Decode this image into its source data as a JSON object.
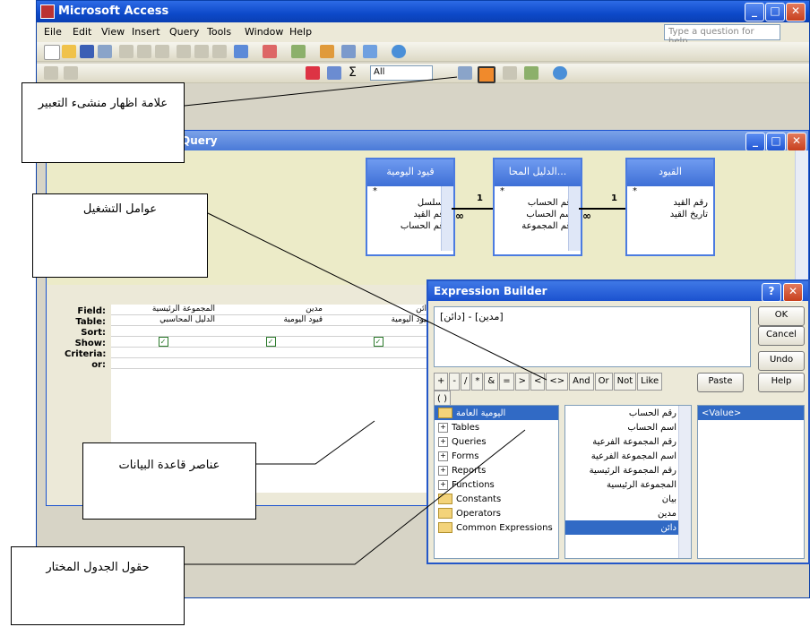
{
  "app": {
    "title": "Microsoft Access",
    "help_placeholder": "Type a question for help"
  },
  "menu": [
    "Eile",
    "Edit",
    "View",
    "Insert",
    "Query",
    "Tools",
    "Window",
    "Help"
  ],
  "toolbar2": {
    "all_value": "All",
    "sigma": "Σ"
  },
  "query_window": {
    "title": "Query",
    "tables": [
      {
        "name": "قيود اليومية",
        "fields": [
          "*",
          "مسلسل",
          "رقم القيد",
          "رقم الحساب"
        ]
      },
      {
        "name": "الدليل المحا...",
        "fields": [
          "*",
          "رقم الحساب",
          "اسم الحساب",
          "رقم المجموعة"
        ]
      },
      {
        "name": "القيود",
        "fields": [
          "*",
          "رقم القيد",
          "تاريخ القيد"
        ]
      }
    ],
    "relation_labels": [
      "1",
      "∞",
      "1",
      "∞"
    ],
    "grid_labels": [
      "Field:",
      "Table:",
      "Sort:",
      "Show:",
      "Criteria:",
      "or:"
    ],
    "columns": [
      {
        "field": "المجموعة الرئيسية",
        "table": "الدليل المحاسبي"
      },
      {
        "field": "مدين",
        "table": "قيود اليومية"
      },
      {
        "field": "دائن",
        "table": "قيود اليومية"
      }
    ]
  },
  "expression_builder": {
    "title": "Expression Builder",
    "expression": "[دائن] - [مدين]",
    "buttons": {
      "ok": "OK",
      "cancel": "Cancel",
      "undo": "Undo",
      "paste": "Paste",
      "help": "Help"
    },
    "operators": [
      "+",
      "-",
      "/",
      "*",
      "&",
      "=",
      ">",
      "<",
      "<>",
      "And",
      "Or",
      "Not",
      "Like",
      "( )"
    ],
    "folders": [
      {
        "label": "اليومية العامة",
        "kind": "folder",
        "selected": true
      },
      {
        "label": "Tables",
        "kind": "plus"
      },
      {
        "label": "Queries",
        "kind": "plus"
      },
      {
        "label": "Forms",
        "kind": "plus"
      },
      {
        "label": "Reports",
        "kind": "plus"
      },
      {
        "label": "Functions",
        "kind": "plus"
      },
      {
        "label": "Constants",
        "kind": "folder"
      },
      {
        "label": "Operators",
        "kind": "folder"
      },
      {
        "label": "Common Expressions",
        "kind": "folder"
      }
    ],
    "fields": [
      "رقم الحساب",
      "اسم الحساب",
      "رقم المجموعة الفرعية",
      "اسم المجموعة الفرعية",
      "رقم المجموعة الرئيسية",
      "المجموعة الرئيسية",
      "بيان",
      "مدين",
      "دائن"
    ],
    "values": [
      "<Value>"
    ]
  },
  "callouts": {
    "builder_icon": "علامة اظهار منشىء التعبير",
    "operators": "عوامل التشغيل",
    "db_elements": "عناصر قاعدة البيانات",
    "table_fields": "حقول الجدول المختار"
  },
  "colors": {
    "titlebar": "#0d49c9",
    "selection": "#316ac5",
    "close": "#c7401e"
  }
}
